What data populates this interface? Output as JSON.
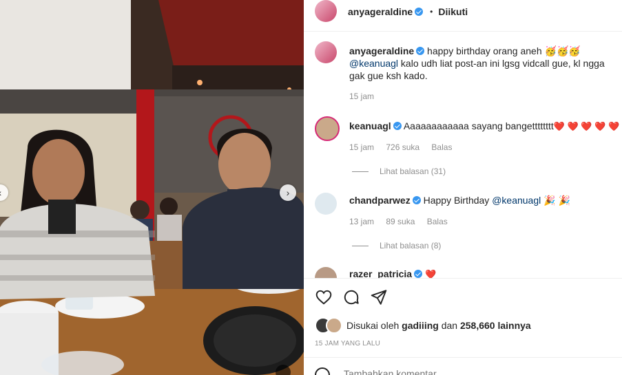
{
  "post": {
    "author": "anyageraldine",
    "follow_status": "Diikuti",
    "separator": "•"
  },
  "caption": {
    "username": "anyageraldine",
    "text_before": "happy birthday orang aneh 🥳🥳🥳",
    "mention": "@keanuagl",
    "text_after": " kalo udh liat post-an ini lgsg vidcall gue, kl ngga gak gue ksh kado.",
    "time": "15 jam"
  },
  "comments": [
    {
      "username": "keanuagl",
      "text": "Aaaaaaaaaaaa sayang bangetttttttt",
      "hearts": "❤️ ❤️ ❤️ ❤️ ❤️",
      "time": "15 jam",
      "likes": "726 suka",
      "reply": "Balas",
      "view_replies": "Lihat balasan (31)"
    },
    {
      "username": "chandparwez",
      "text_before": "Happy Birthday ",
      "mention": "@keanuagl",
      "emoji": " 🎉 🎉",
      "time": "13 jam",
      "likes": "89 suka",
      "reply": "Balas",
      "view_replies": "Lihat balasan (8)"
    },
    {
      "username": "razer_patricia",
      "hearts": "❤️"
    }
  ],
  "actions": {
    "like_icon": "heart-outline-icon",
    "comment_icon": "comment-icon",
    "share_icon": "send-icon"
  },
  "likes_summary": {
    "prefix": "Disukai oleh ",
    "user": "gadiiing",
    "middle": " dan ",
    "count": "258,660",
    "suffix": " lainnya"
  },
  "timestamp": "15 JAM YANG LALU",
  "comment_input": {
    "placeholder": "Tambahkan komentar..."
  },
  "colors": {
    "verified": "#3897f0",
    "heart": "#ed4956",
    "mention": "#00376b",
    "muted": "#8e8e8e"
  }
}
